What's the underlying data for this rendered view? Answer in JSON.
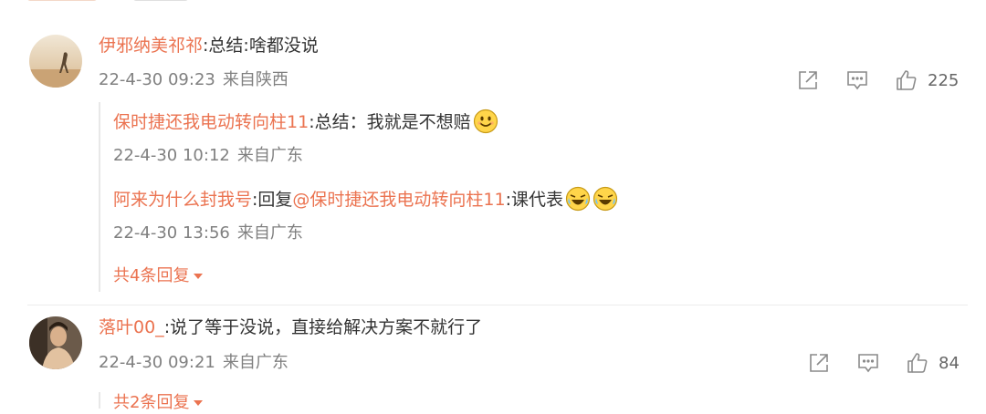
{
  "comments": [
    {
      "user": "伊邪纳美祁祁",
      "text": ":总结:啥都没说",
      "time": "22-4-30 09:23",
      "location": "来自陕西",
      "likes": "225",
      "replies": [
        {
          "user": "保时捷还我电动转向柱11",
          "text": ":总结：我就是不想赔",
          "emojis": [
            "smile-emoji"
          ],
          "time": "22-4-30 10:12",
          "location": "来自广东"
        },
        {
          "user": "阿来为什么封我号",
          "text_prefix": ":回复",
          "mention": "@保时捷还我电动转向柱11",
          "text": ":课代表",
          "emojis": [
            "laugh-cry-emoji",
            "laugh-cry-emoji"
          ],
          "time": "22-4-30 13:56",
          "location": "来自广东"
        }
      ],
      "more_replies": "共4条回复"
    },
    {
      "user": "落叶00_",
      "text": ":说了等于没说，直接给解决方案不就行了",
      "time": "22-4-30 09:21",
      "location": "来自广东",
      "likes": "84",
      "more_replies": "共2条回复"
    }
  ],
  "icons": {
    "share": "share-icon",
    "comment": "comment-icon",
    "like": "thumbs-up-icon"
  },
  "colors": {
    "username": "#eb7350",
    "meta": "#808080",
    "text": "#333333"
  }
}
